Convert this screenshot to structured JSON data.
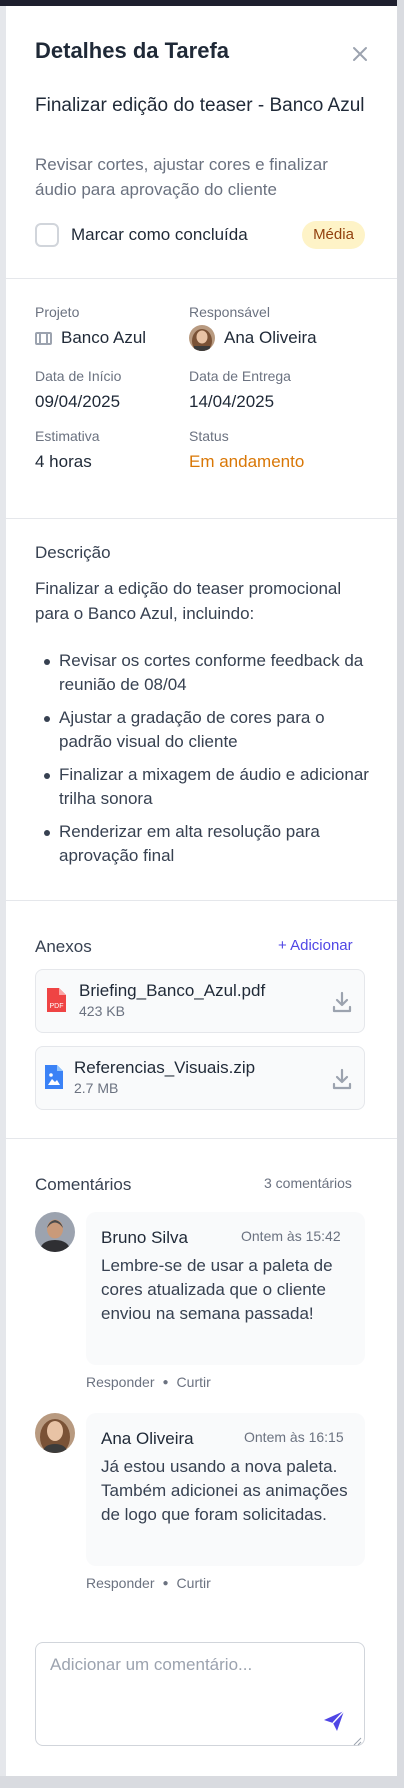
{
  "header": {
    "title": "Detalhes da Tarefa",
    "close_icon": "close-icon"
  },
  "task": {
    "title": "Finalizar edição do teaser - Banco Azul",
    "subtitle": "Revisar cortes, ajustar cores e finalizar áudio para aprovação do cliente",
    "checkbox_label": "Marcar como concluída",
    "priority": "Média",
    "completed": false
  },
  "details": {
    "project_label": "Projeto",
    "project_value": "Banco Azul",
    "assignee_label": "Responsável",
    "assignee_value": "Ana Oliveira",
    "start_label": "Data de Início",
    "start_value": "09/04/2025",
    "due_label": "Data de Entrega",
    "due_value": "14/04/2025",
    "estimate_label": "Estimativa",
    "estimate_value": "4 horas",
    "status_label": "Status",
    "status_value": "Em andamento"
  },
  "description": {
    "title": "Descrição",
    "intro": "Finalizar a edição do teaser promocional para o Banco Azul, incluindo:",
    "items": [
      "Revisar os cortes conforme feedback da reunião de 08/04",
      "Ajustar a gradação de cores para o padrão visual do cliente",
      "Finalizar a mixagem de áudio e adicionar trilha sonora",
      "Renderizar em alta resolução para aprovação final"
    ]
  },
  "attachments": {
    "title": "Anexos",
    "add_label": "+ Adicionar",
    "files": [
      {
        "name": "Briefing_Banco_Azul.pdf",
        "size": "423 KB",
        "icon": "pdf-file-icon"
      },
      {
        "name": "Referencias_Visuais.zip",
        "size": "2.7 MB",
        "icon": "image-file-icon"
      }
    ]
  },
  "comments": {
    "title": "Comentários",
    "count": "3 comentários",
    "reply_label": "Responder",
    "like_label": "Curtir",
    "items": [
      {
        "author": "Bruno Silva",
        "time": "Ontem às 15:42",
        "text": "Lembre-se de usar a paleta de cores atualizada que o cliente enviou na semana passada!"
      },
      {
        "author": "Ana Oliveira",
        "time": "Ontem às 16:15",
        "text": "Já estou usando a nova paleta. Também adicionei as animações de logo que foram solicitadas."
      }
    ],
    "input_placeholder": "Adicionar um comentário...",
    "send_icon": "send-icon"
  },
  "colors": {
    "accent": "#4f46e5",
    "status_orange": "#d97706",
    "badge_bg": "#fef3c7",
    "badge_text": "#92400e"
  }
}
